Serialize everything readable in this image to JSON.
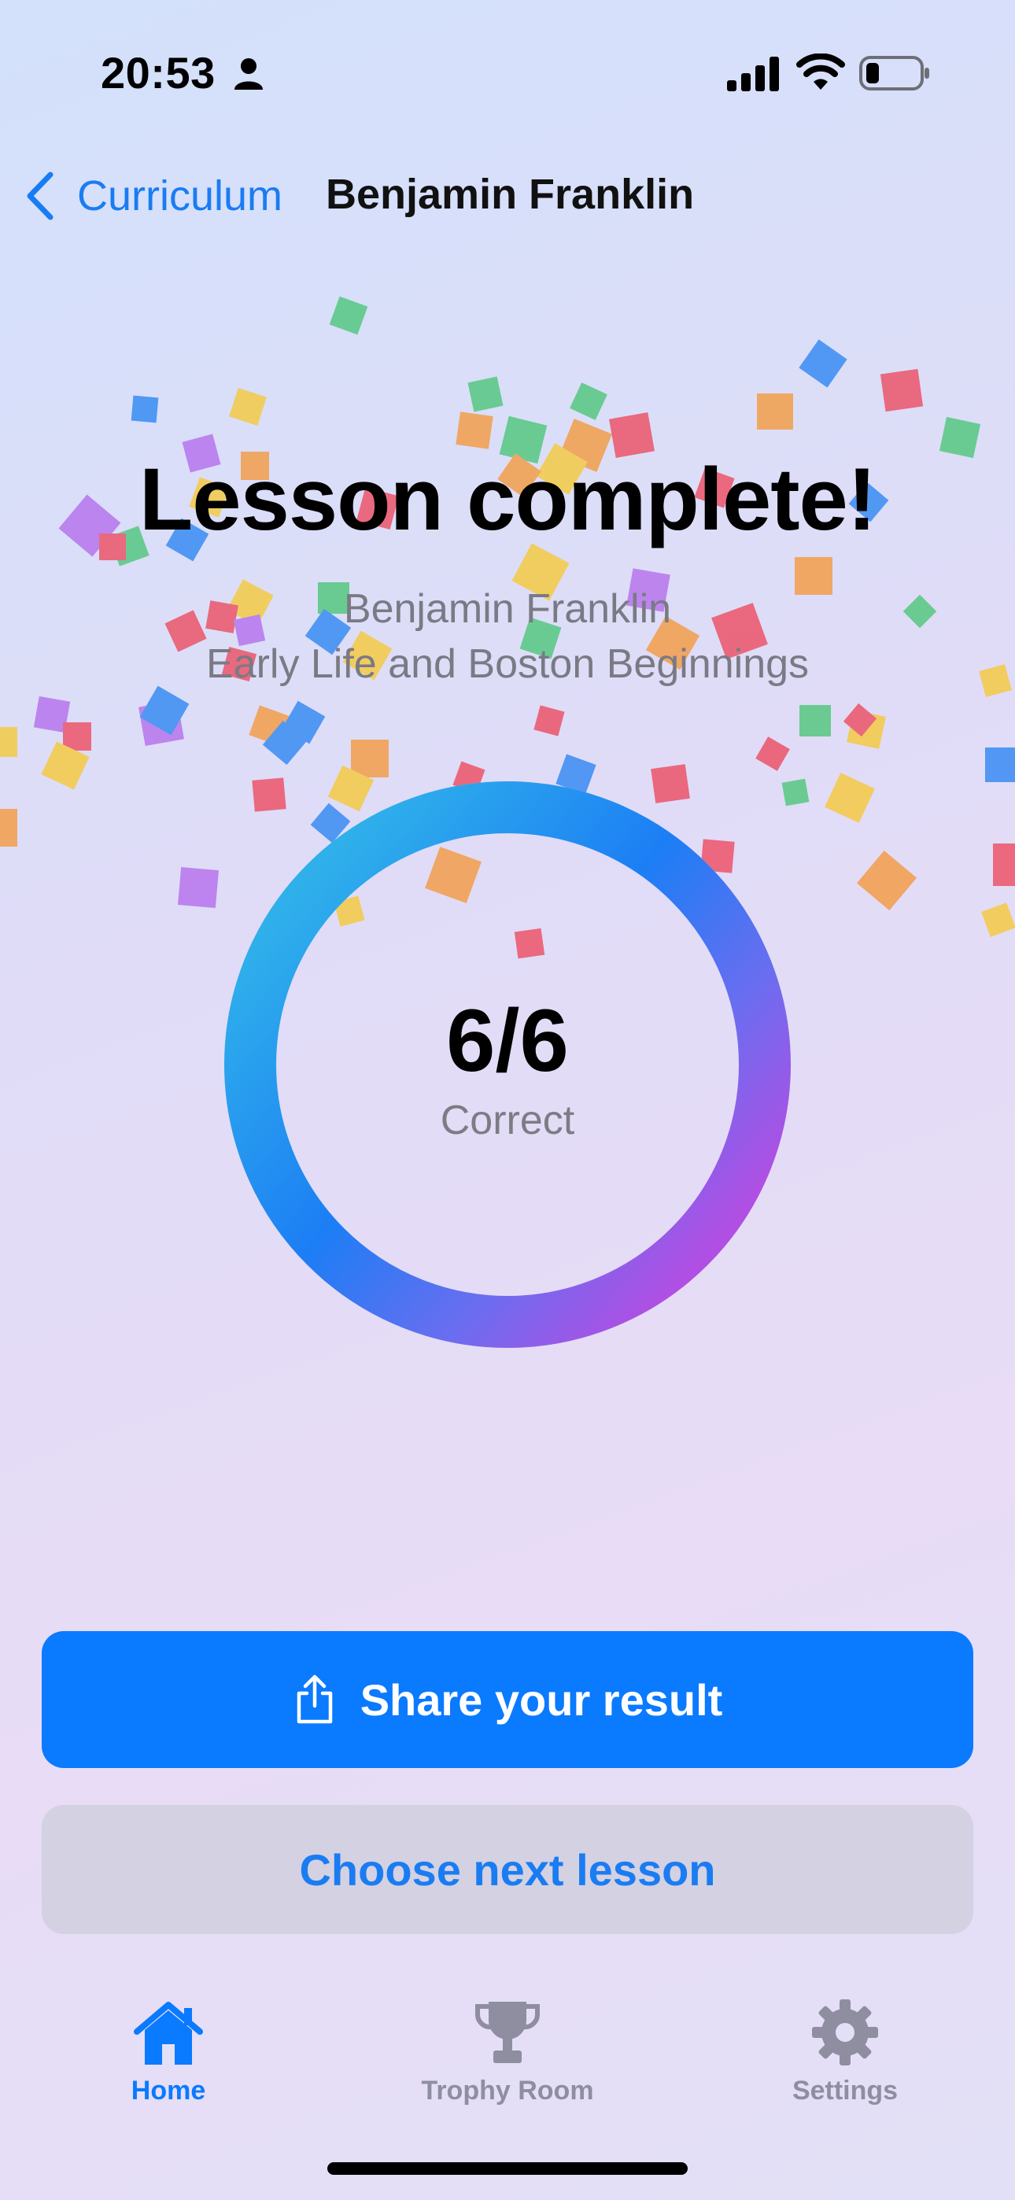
{
  "status_bar": {
    "time": "20:53"
  },
  "nav": {
    "back_label": "Curriculum",
    "title": "Benjamin Franklin"
  },
  "lesson": {
    "heading": "Lesson complete!",
    "subject": "Benjamin Franklin",
    "chapter": "Early Life and Boston Beginnings"
  },
  "score": {
    "value": "6/6",
    "label": "Correct",
    "fraction": 1.0
  },
  "buttons": {
    "share_label": "Share your result",
    "next_label": "Choose next lesson"
  },
  "tabs": [
    {
      "label": "Home",
      "icon": "house-icon",
      "active": true
    },
    {
      "label": "Trophy Room",
      "icon": "trophy-icon",
      "active": false
    },
    {
      "label": "Settings",
      "icon": "gear-icon",
      "active": false
    }
  ],
  "colors": {
    "accent": "#0a7aff",
    "ring_start": "#2fb0ea",
    "ring_end": "#b04fe3",
    "inactive_tab": "#8e8ea0"
  }
}
